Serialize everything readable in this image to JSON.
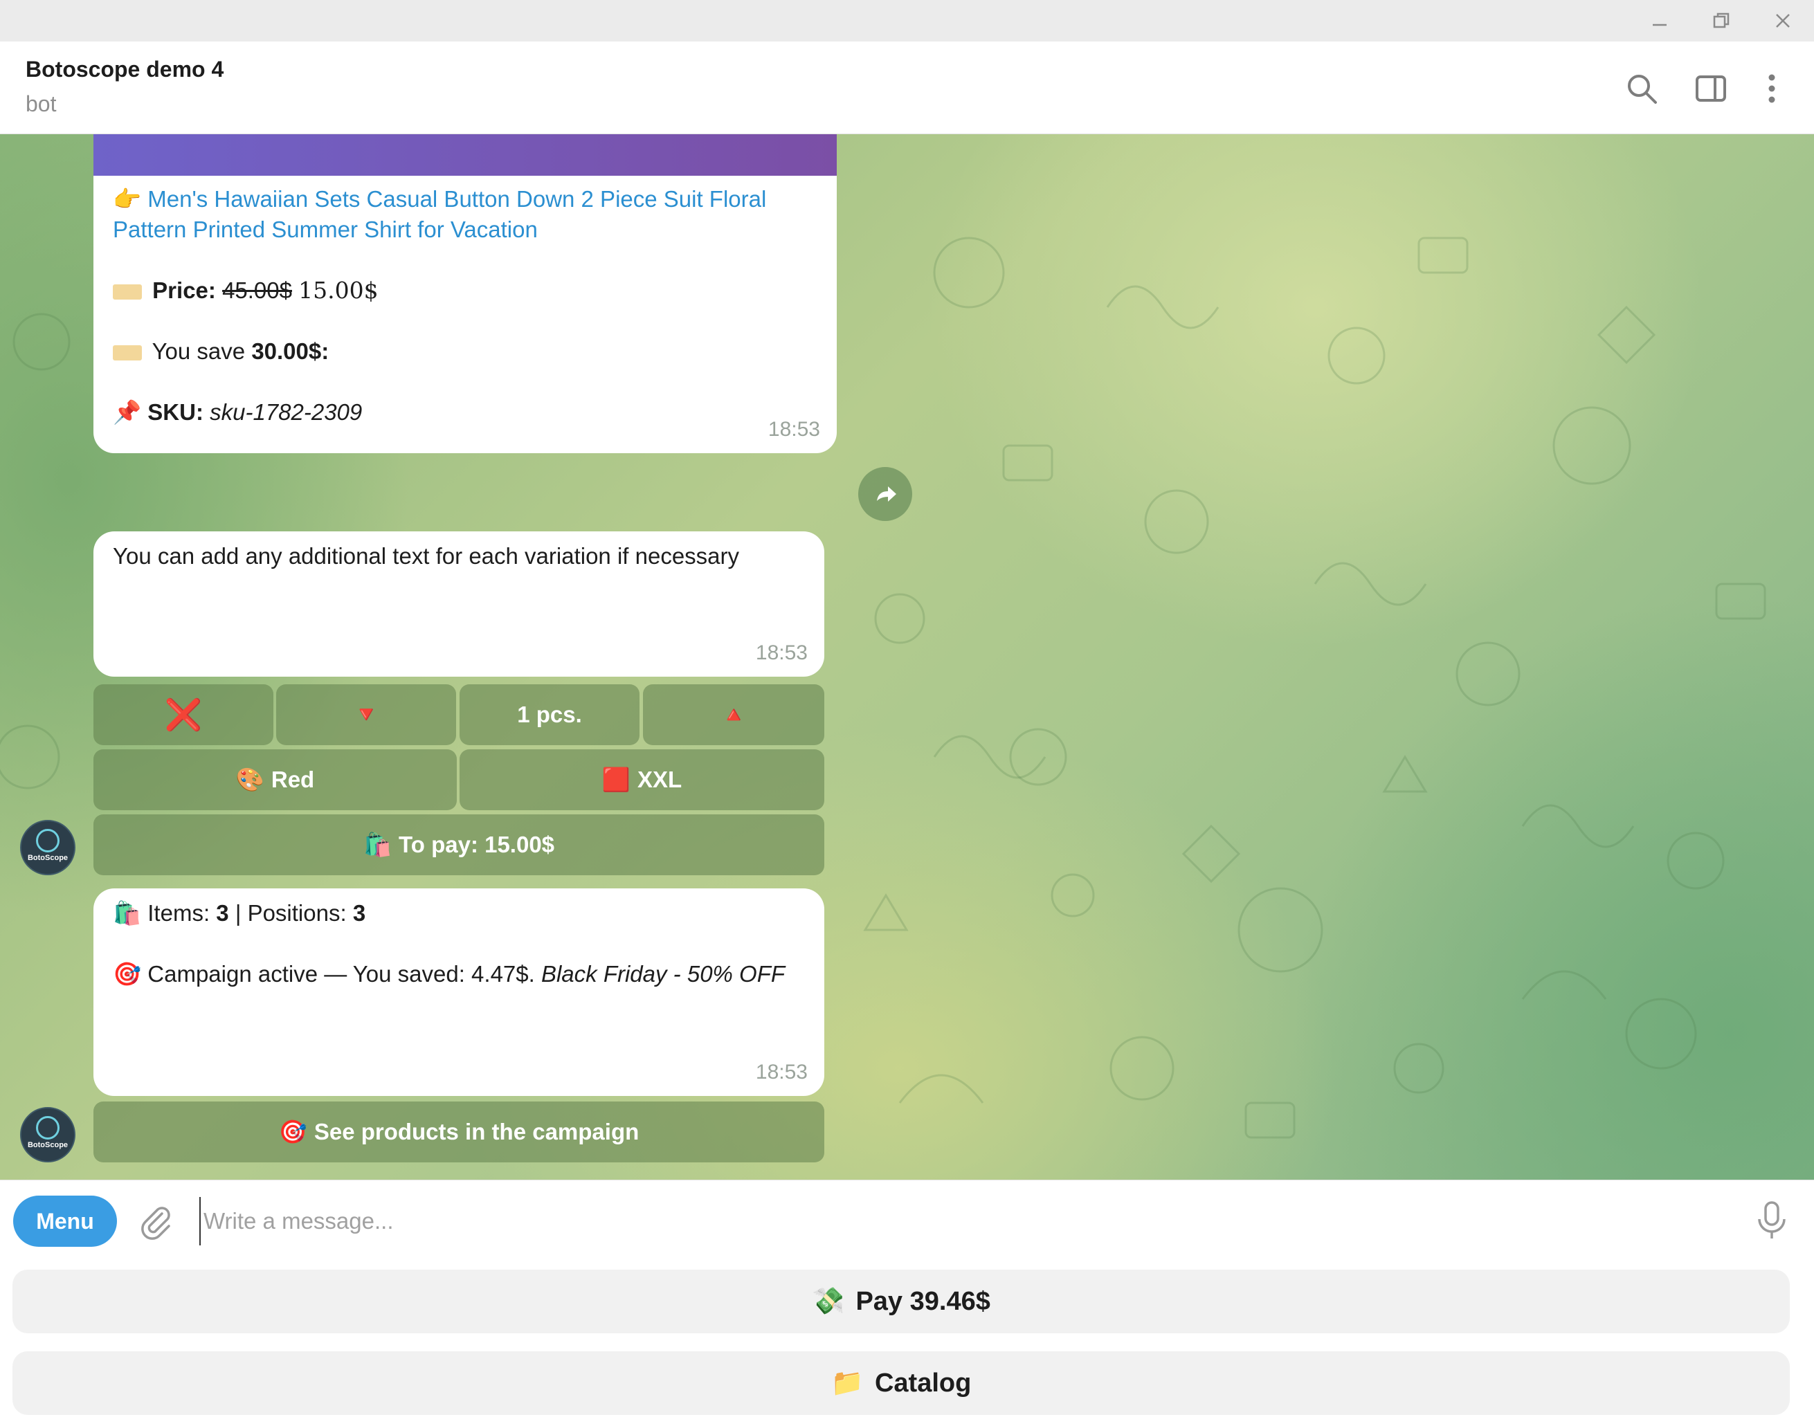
{
  "window": {
    "minimize_icon": "minimize-icon",
    "restore_icon": "restore-icon",
    "close_icon": "close-icon"
  },
  "header": {
    "title": "Botoscope demo 4",
    "subtitle": "bot"
  },
  "messages": {
    "product": {
      "link_emoji": "👉",
      "link_line1": "Men's Hawaiian Sets Casual Button Down 2 Piece Suit Floral",
      "link_line2": "Pattern Printed Summer Shirt for Vacation",
      "price_label": "Price:",
      "price_old": "45.00$",
      "price_new": "15.00$",
      "save_prefix": "You save ",
      "save_amount": "30.00$:",
      "sku_emoji": "📌",
      "sku_label": "SKU:",
      "sku_value": "sku-1782-2309",
      "time": "18:53"
    },
    "variation": {
      "text": "You can add any additional text for each variation if necessary",
      "time": "18:53",
      "keyboard": {
        "remove": "❌",
        "decrease": "🔻",
        "quantity": "1 pcs.",
        "increase": "🔺",
        "color_emoji": "🎨",
        "color": "Red",
        "size_emoji": "🟥",
        "size": "XXL",
        "pay_emoji": "🛍️",
        "pay": "To pay: 15.00$"
      }
    },
    "cart": {
      "items_emoji": "🛍️",
      "items_label": "Items: ",
      "items_count": "3",
      "sep": " | Positions: ",
      "positions_count": "3",
      "campaign_emoji": "🎯",
      "campaign_text": "Campaign active — You saved: 4.47$. ",
      "campaign_name": "Black Friday - 50% OFF",
      "time": "18:53",
      "button_emoji": "🎯",
      "button": "See products in the campaign"
    }
  },
  "avatar": {
    "text": "BotoScope"
  },
  "composer": {
    "menu_label": "Menu",
    "placeholder": "Write a message..."
  },
  "reply_keyboard": {
    "pay_emoji": "💸",
    "pay_label": "Pay 39.46$",
    "catalog_emoji": "📁",
    "catalog_label": "Catalog"
  },
  "colors": {
    "accent": "#3a9de3",
    "link": "#2b8fd1",
    "inline_button": "#60804c"
  }
}
